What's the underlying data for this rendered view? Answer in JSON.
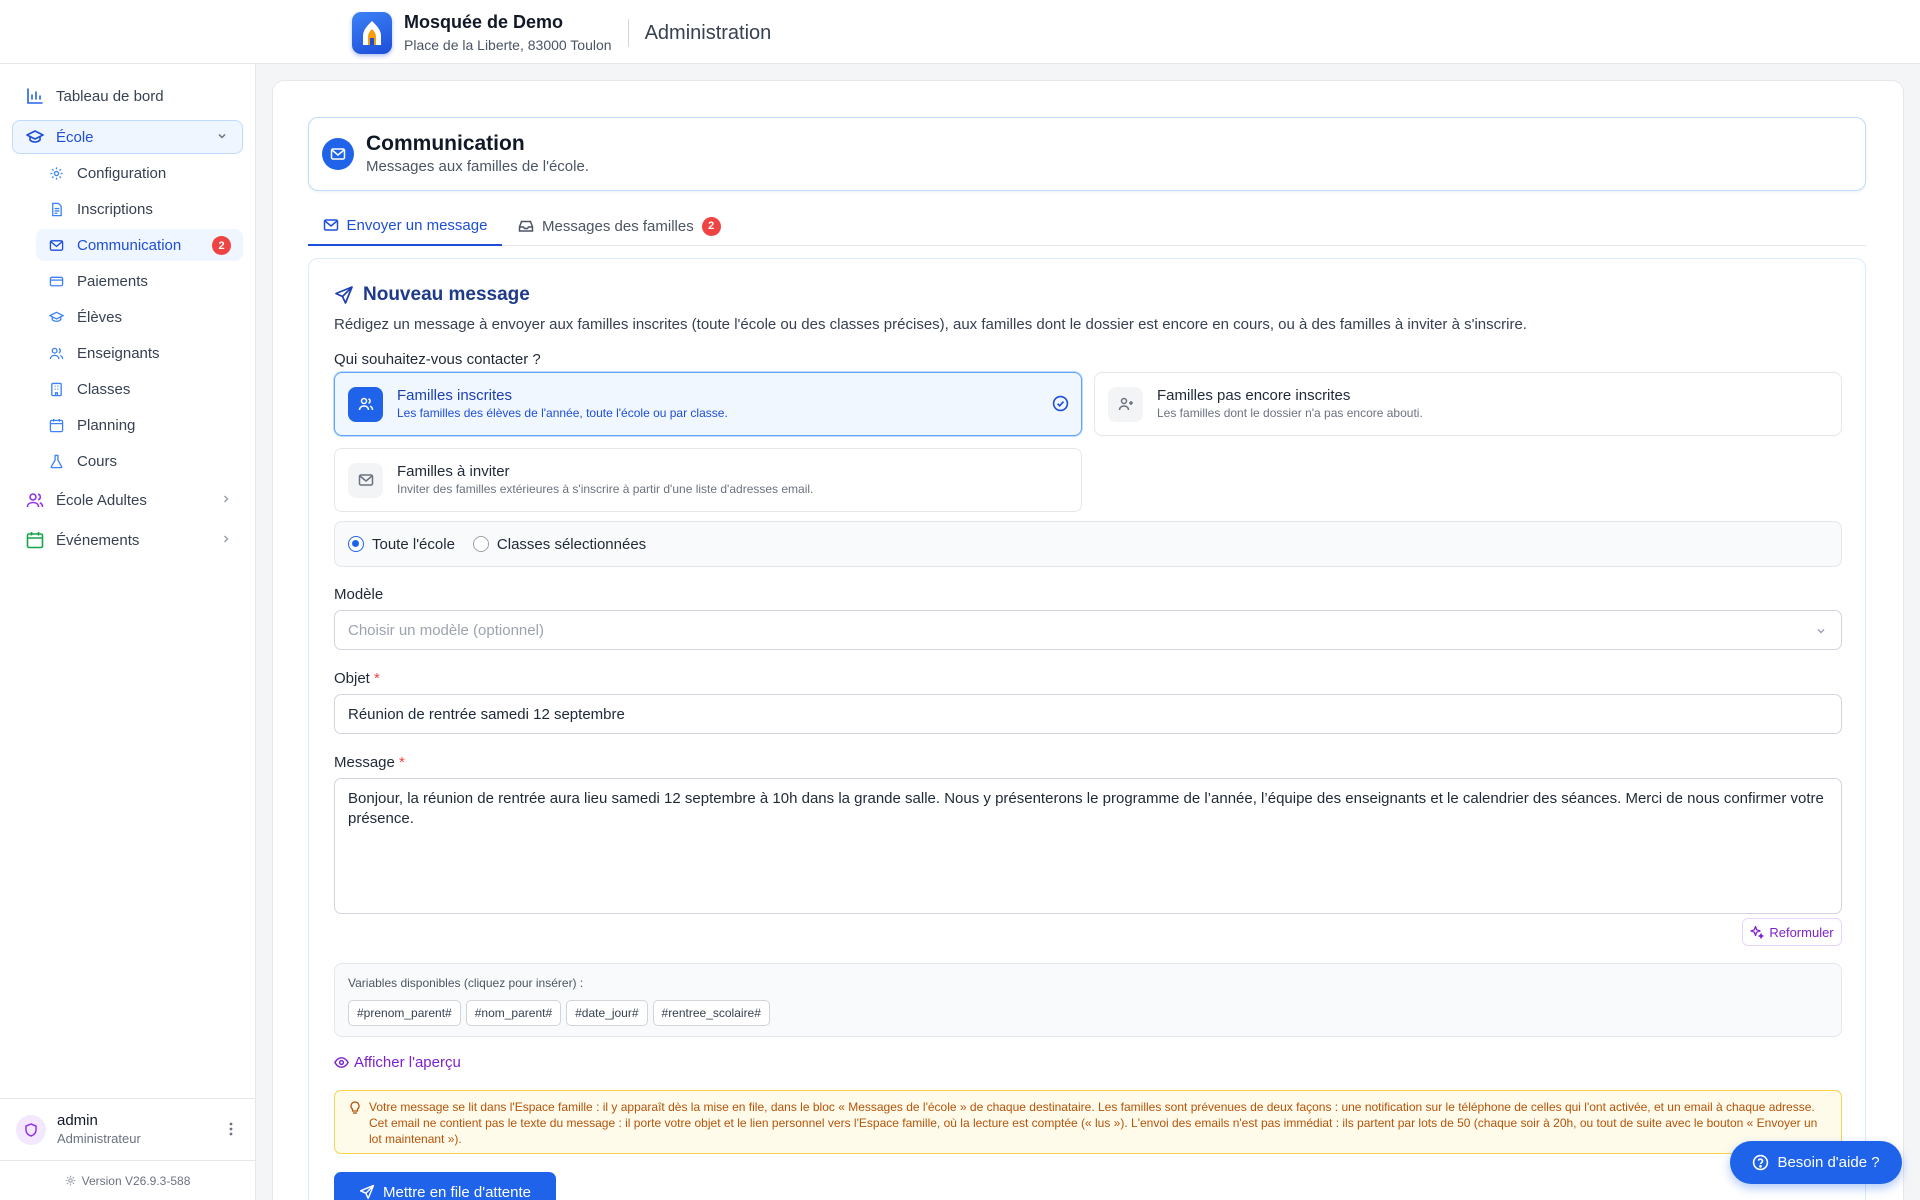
{
  "header": {
    "org_name": "Mosquée de Demo",
    "org_address": "Place de la Liberte, 83000 Toulon",
    "section": "Administration"
  },
  "sidebar": {
    "items": [
      {
        "label": "Tableau de bord",
        "icon": "bar-chart-icon"
      },
      {
        "label": "École",
        "icon": "graduation-cap-icon",
        "expanded": true
      },
      {
        "label": "École Adultes",
        "icon": "users-icon"
      },
      {
        "label": "Événements",
        "icon": "calendar-icon"
      }
    ],
    "sub_items": [
      {
        "label": "Configuration",
        "icon": "gear-icon"
      },
      {
        "label": "Inscriptions",
        "icon": "file-text-icon"
      },
      {
        "label": "Communication",
        "icon": "mail-icon",
        "badge": "2",
        "active": true
      },
      {
        "label": "Paiements",
        "icon": "credit-card-icon"
      },
      {
        "label": "Élèves",
        "icon": "graduation-cap-icon"
      },
      {
        "label": "Enseignants",
        "icon": "users-icon"
      },
      {
        "label": "Classes",
        "icon": "building-icon"
      },
      {
        "label": "Planning",
        "icon": "calendar-icon"
      },
      {
        "label": "Cours",
        "icon": "flask-icon"
      }
    ],
    "user": {
      "name": "admin",
      "role": "Administrateur"
    },
    "version": "Version V26.9.3-588"
  },
  "page": {
    "title": "Communication",
    "subtitle": "Messages aux familles de l'école."
  },
  "tabs": [
    {
      "label": "Envoyer un message",
      "active": true
    },
    {
      "label": "Messages des familles",
      "badge": "2"
    }
  ],
  "form": {
    "title": "Nouveau message",
    "description": "Rédigez un message à envoyer aux familles inscrites (toute l'école ou des classes précises), aux familles dont le dossier est encore en cours, ou à des familles à inviter à s'inscrire.",
    "recipient_question": "Qui souhaitez-vous contacter ?",
    "recipient_options": [
      {
        "title": "Familles inscrites",
        "subtitle": "Les familles des élèves de l'année, toute l'école ou par classe.",
        "selected": true
      },
      {
        "title": "Familles pas encore inscrites",
        "subtitle": "Les familles dont le dossier n'a pas encore abouti."
      },
      {
        "title": "Familles à inviter",
        "subtitle": "Inviter des familles extérieures à s'inscrire à partir d'une liste d'adresses email."
      }
    ],
    "scope_options": [
      {
        "label": "Toute l'école",
        "checked": true
      },
      {
        "label": "Classes sélectionnées",
        "checked": false
      }
    ],
    "template_label": "Modèle",
    "template_placeholder": "Choisir un modèle (optionnel)",
    "subject_label": "Objet",
    "required_mark": "*",
    "subject_value": "Réunion de rentrée samedi 12 septembre",
    "message_label": "Message",
    "message_value": "Bonjour, la réunion de rentrée aura lieu samedi 12 septembre à 10h dans la grande salle. Nous y présenterons le programme de l’année, l’équipe des enseignants et le calendrier des séances. Merci de nous confirmer votre présence.",
    "reformulate_label": "Reformuler",
    "variables_label": "Variables disponibles (cliquez pour insérer) :",
    "variables": [
      "#prenom_parent#",
      "#nom_parent#",
      "#date_jour#",
      "#rentree_scolaire#"
    ],
    "preview_label": "Afficher l'aperçu",
    "notice": "Votre message se lit dans l'Espace famille : il y apparaît dès la mise en file, dans le bloc « Messages de l'école » de chaque destinataire. Les familles sont prévenues de deux façons : une notification sur le téléphone de celles qui l'ont activée, et un email à chaque adresse. Cet email ne contient pas le texte du message : il porte votre objet et le lien personnel vers l'Espace famille, où la lecture est comptée (« lus »). L'envoi des emails n'est pas immédiat : ils partent par lots de 50 (chaque soir à 20h, ou tout de suite avec le bouton « Envoyer un lot maintenant »).",
    "queue_button": "Mettre en file d'attente"
  },
  "help_button": "Besoin d'aide ?",
  "colors": {
    "accent": "#1e63e9",
    "badge": "#ef4444",
    "purple": "#7e22ce",
    "warning_bg": "#fffbeb"
  }
}
